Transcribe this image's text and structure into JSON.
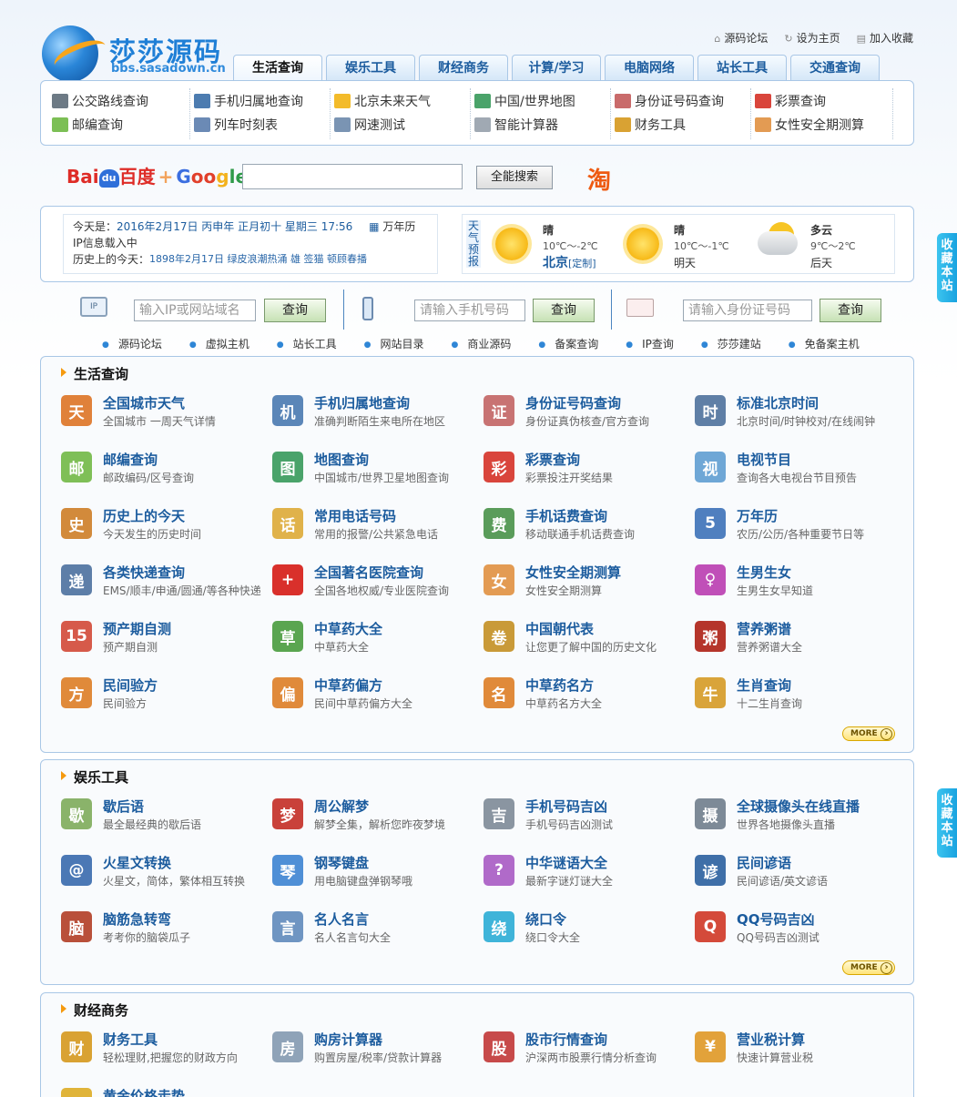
{
  "logo": {
    "title": "莎莎源码",
    "subtitle": "bbs.sasadown.cn"
  },
  "toplinks": [
    {
      "label": "源码论坛",
      "icon": "home-icon"
    },
    {
      "label": "设为主页",
      "icon": "refresh-icon"
    },
    {
      "label": "加入收藏",
      "icon": "bookmark-icon"
    }
  ],
  "tabs": [
    "生活查询",
    "娱乐工具",
    "财经商务",
    "计算/学习",
    "电脑网络",
    "站长工具",
    "交通查询"
  ],
  "quick": [
    {
      "label": "公交路线查询",
      "icon": "bus-icon",
      "color": "#6d7a85"
    },
    {
      "label": "邮编查询",
      "icon": "postcode-icon",
      "color": "#7cbf55"
    },
    {
      "label": "手机归属地查询",
      "icon": "phone-icon",
      "color": "#4d7cb0"
    },
    {
      "label": "列车时刻表",
      "icon": "train-icon",
      "color": "#6b8ab5"
    },
    {
      "label": "北京未来天气",
      "icon": "weather-icon",
      "color": "#f3bb2a"
    },
    {
      "label": "网速测试",
      "icon": "speed-icon",
      "color": "#7a94b3"
    },
    {
      "label": "中国/世界地图",
      "icon": "map-icon",
      "color": "#4aa36a"
    },
    {
      "label": "智能计算器",
      "icon": "calculator-icon",
      "color": "#a0a9b3"
    },
    {
      "label": "身份证号码查询",
      "icon": "id-card-icon",
      "color": "#c96b6b"
    },
    {
      "label": "财务工具",
      "icon": "finance-icon",
      "color": "#d9a233"
    },
    {
      "label": "彩票查询",
      "icon": "lottery-icon",
      "color": "#d9453c"
    },
    {
      "label": "女性安全期测算",
      "icon": "woman-icon",
      "color": "#e39b53"
    }
  ],
  "search": {
    "baidu_b": "Bai",
    "baidu_du": "du",
    "baidu_cn": "百度",
    "plus": "+",
    "google": [
      "G",
      "oo",
      "g",
      "le"
    ],
    "button": "全能搜索",
    "taobao": "淘"
  },
  "info": {
    "today_label": "今天是：",
    "today_value": "2016年2月17日  丙申年  正月初十  星期三  17:56",
    "calendar_link": "万年历",
    "ip_status": "IP信息载入中",
    "history_label": "历史上的今天：",
    "history_text": "1898年2月17日 绿皮浪潮热涌  雄  签猫  顿顾春播"
  },
  "weather": {
    "label": "天气预报",
    "days": [
      {
        "cond": "晴",
        "temp": "10℃～-2℃",
        "place": "北京",
        "custom": "[定制]",
        "type": "sunny"
      },
      {
        "cond": "晴",
        "temp": "10℃～-1℃",
        "place": "明天",
        "custom": "",
        "type": "sunny"
      },
      {
        "cond": "多云",
        "temp": "9℃～2℃",
        "place": "后天",
        "custom": "",
        "type": "cloudy"
      }
    ]
  },
  "lookups": [
    {
      "placeholder": "输入IP或网站域名",
      "button": "查询",
      "icon": "ip-monitor-icon"
    },
    {
      "placeholder": "请输入手机号码",
      "button": "查询",
      "icon": "phone-lookup-icon"
    },
    {
      "placeholder": "请输入身份证号码",
      "button": "查询",
      "icon": "id-card-lookup-icon"
    }
  ],
  "navlinks": [
    "源码论坛",
    "虚拟主机",
    "站长工具",
    "网站目录",
    "商业源码",
    "备案查询",
    "IP查询",
    "莎莎建站",
    "免备案主机"
  ],
  "sections": [
    {
      "title": "生活查询",
      "more": "MORE",
      "items": [
        {
          "title": "全国城市天气",
          "desc": "全国城市 一周天气详情",
          "icon": "china-map-icon",
          "color": "#e0813a",
          "glyph": "天"
        },
        {
          "title": "手机归属地查询",
          "desc": "准确判断陌生来电所在地区",
          "icon": "phone-eye-icon",
          "color": "#5b86b8",
          "glyph": "机"
        },
        {
          "title": "身份证号码查询",
          "desc": "身份证真伪核查/官方查询",
          "icon": "id-card-icon",
          "color": "#c87373",
          "glyph": "证"
        },
        {
          "title": "标准北京时间",
          "desc": "北京时间/时钟校对/在线闹钟",
          "icon": "clock-icon",
          "color": "#5f7fa6",
          "glyph": "时"
        },
        {
          "title": "邮编查询",
          "desc": "邮政编码/区号查询",
          "icon": "postcode-icon",
          "color": "#7fbf57",
          "glyph": "邮"
        },
        {
          "title": "地图查询",
          "desc": "中国城市/世界卫星地图查询",
          "icon": "map-icon",
          "color": "#4aa36a",
          "glyph": "图"
        },
        {
          "title": "彩票查询",
          "desc": "彩票投注开奖结果",
          "icon": "lottery-icon",
          "color": "#d9453c",
          "glyph": "彩"
        },
        {
          "title": "电视节目",
          "desc": "查询各大电视台节目预告",
          "icon": "tv-icon",
          "color": "#6fa7d6",
          "glyph": "视"
        },
        {
          "title": "历史上的今天",
          "desc": "今天发生的历史时间",
          "icon": "history-clock-icon",
          "color": "#d28a3b",
          "glyph": "史"
        },
        {
          "title": "常用电话号码",
          "desc": "常用的报警/公共紧急电话",
          "icon": "phone-book-icon",
          "color": "#e0b24a",
          "glyph": "话"
        },
        {
          "title": "手机话费查询",
          "desc": "移动联通手机话费查询",
          "icon": "phone-bill-icon",
          "color": "#5a9c5a",
          "glyph": "费"
        },
        {
          "title": "万年历",
          "desc": "农历/公历/各种重要节日等",
          "icon": "calendar-icon",
          "color": "#4f7fbf",
          "glyph": "5"
        },
        {
          "title": "各类快递查询",
          "desc": "EMS/顺丰/申通/圆通/等各种快递",
          "icon": "envelope-icon",
          "color": "#5d7ea8",
          "glyph": "递"
        },
        {
          "title": "全国著名医院查询",
          "desc": "全国各地权威/专业医院查询",
          "icon": "hospital-cross-icon",
          "color": "#d9302b",
          "glyph": "+"
        },
        {
          "title": "女性安全期测算",
          "desc": "女性安全期测算",
          "icon": "woman-icon",
          "color": "#e39b53",
          "glyph": "女"
        },
        {
          "title": "生男生女",
          "desc": "生男生女早知道",
          "icon": "gender-icon",
          "color": "#c04fb8",
          "glyph": "♀"
        },
        {
          "title": "预产期自测",
          "desc": "预产期自测",
          "icon": "due-date-calendar-icon",
          "color": "#d65a4a",
          "glyph": "15"
        },
        {
          "title": "中草药大全",
          "desc": "中草药大全",
          "icon": "herb-icon",
          "color": "#5aa550",
          "glyph": "草"
        },
        {
          "title": "中国朝代表",
          "desc": "让您更了解中国的历史文化",
          "icon": "scroll-icon",
          "color": "#c99a38",
          "glyph": "卷"
        },
        {
          "title": "营养粥谱",
          "desc": "营养粥谱大全",
          "icon": "porridge-icon",
          "color": "#b5352b",
          "glyph": "粥"
        },
        {
          "title": "民间验方",
          "desc": "民间验方",
          "icon": "pencil-ruler-icon",
          "color": "#e08a3a",
          "glyph": "方"
        },
        {
          "title": "中草药偏方",
          "desc": "民间中草药偏方大全",
          "icon": "pencil-ruler-icon",
          "color": "#e08a3a",
          "glyph": "偏"
        },
        {
          "title": "中草药名方",
          "desc": "中草药名方大全",
          "icon": "pencil-ruler-icon",
          "color": "#e08a3a",
          "glyph": "名"
        },
        {
          "title": "生肖查询",
          "desc": "十二生肖查询",
          "icon": "ox-icon",
          "color": "#d9a43a",
          "glyph": "牛"
        }
      ]
    },
    {
      "title": "娱乐工具",
      "more": "MORE",
      "items": [
        {
          "title": "歇后语",
          "desc": "最全最经典的歇后语",
          "icon": "proverb-icon",
          "color": "#8ab36a",
          "glyph": "歇"
        },
        {
          "title": "周公解梦",
          "desc": "解梦全集，解析您昨夜梦境",
          "icon": "zhougong-icon",
          "color": "#c9413a",
          "glyph": "梦"
        },
        {
          "title": "手机号码吉凶",
          "desc": "手机号码吉凶测试",
          "icon": "phone-fortune-icon",
          "color": "#8a95a1",
          "glyph": "吉"
        },
        {
          "title": "全球摄像头在线直播",
          "desc": "世界各地摄像头直播",
          "icon": "webcam-icon",
          "color": "#7d8a97",
          "glyph": "摄"
        },
        {
          "title": "火星文转换",
          "desc": "火星文，简体，繁体相互转换",
          "icon": "martian-text-icon",
          "color": "#4b78b5",
          "glyph": "@"
        },
        {
          "title": "钢琴键盘",
          "desc": "用电脑键盘弹钢琴哦",
          "icon": "piano-robot-icon",
          "color": "#4f8fd6",
          "glyph": "琴"
        },
        {
          "title": "中华谜语大全",
          "desc": "最新字谜灯谜大全",
          "icon": "riddle-icon",
          "color": "#b06ac9",
          "glyph": "?"
        },
        {
          "title": "民间谚语",
          "desc": "民间谚语/英文谚语",
          "icon": "proverb-sign-icon",
          "color": "#3f6fa8",
          "glyph": "谚"
        },
        {
          "title": "脑筋急转弯",
          "desc": "考考你的脑袋瓜子",
          "icon": "drum-icon",
          "color": "#b9503a",
          "glyph": "脑"
        },
        {
          "title": "名人名言",
          "desc": "名人名言句大全",
          "icon": "speech-bubble-icon",
          "color": "#6f95c2",
          "glyph": "言"
        },
        {
          "title": "绕口令",
          "desc": "绕口令大全",
          "icon": "tongue-twister-icon",
          "color": "#3fb4d9",
          "glyph": "绕"
        },
        {
          "title": "QQ号码吉凶",
          "desc": "QQ号码吉凶测试",
          "icon": "qq-penguin-icon",
          "color": "#d44a3a",
          "glyph": "Q"
        }
      ]
    },
    {
      "title": "财经商务",
      "more": "",
      "items": [
        {
          "title": "财务工具",
          "desc": "轻松理财,把握您的财政方向",
          "icon": "finance-calc-icon",
          "color": "#d9a233",
          "glyph": "财"
        },
        {
          "title": "购房计算器",
          "desc": "购置房屋/税率/贷款计算器",
          "icon": "house-calc-icon",
          "color": "#8fa3b8",
          "glyph": "房"
        },
        {
          "title": "股市行情查询",
          "desc": "沪深两市股票行情分析查询",
          "icon": "stock-chart-icon",
          "color": "#c74a4a",
          "glyph": "股"
        },
        {
          "title": "营业税计算",
          "desc": "快速计算营业税",
          "icon": "shopping-cart-icon",
          "color": "#e2a23a",
          "glyph": "¥"
        },
        {
          "title": "黄金价格走势",
          "desc": "",
          "icon": "gold-icon",
          "color": "#e0b43a",
          "glyph": "金"
        }
      ]
    }
  ],
  "sidetabs": [
    "收藏本站",
    "收藏本站"
  ]
}
